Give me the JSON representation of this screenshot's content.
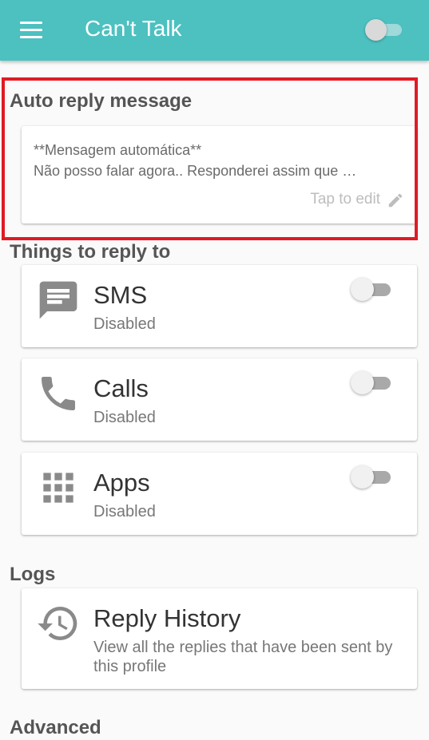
{
  "app": {
    "title": "Can't Talk",
    "menu_icon": "hamburger-menu-icon",
    "profile_switch": "off"
  },
  "auto_reply": {
    "section_title": "Auto reply message",
    "message_line1": "**Mensagem automática**",
    "message_line2": "Não posso falar agora.. Responderei assim que …",
    "tap_to_edit": "Tap to edit",
    "edit_icon": "pencil-icon"
  },
  "things_to_reply": {
    "section_title": "Things to reply to",
    "items": [
      {
        "title": "SMS",
        "status": "Disabled",
        "icon": "message-icon",
        "enabled": false
      },
      {
        "title": "Calls",
        "status": "Disabled",
        "icon": "phone-icon",
        "enabled": false
      },
      {
        "title": "Apps",
        "status": "Disabled",
        "icon": "apps-grid-icon",
        "enabled": false
      }
    ]
  },
  "logs": {
    "section_title": "Logs",
    "reply_history": {
      "title": "Reply History",
      "description_line1": "View all the replies that have been sent by",
      "description_line2": "this profile",
      "icon": "history-icon"
    }
  },
  "advanced": {
    "section_title": "Advanced"
  },
  "colors": {
    "app_bar": "#4dc0c0",
    "highlight": "#e01b24"
  }
}
